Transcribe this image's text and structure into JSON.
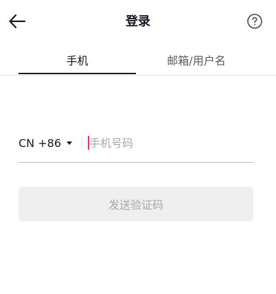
{
  "header": {
    "title": "登录",
    "back_icon": "arrow-left-icon",
    "help_icon": "question-circle-icon"
  },
  "tabs": [
    {
      "label": "手机",
      "active": true
    },
    {
      "label": "邮箱/用户名",
      "active": false
    }
  ],
  "phone": {
    "country_code": "CN +86",
    "placeholder": "手机号码",
    "value": ""
  },
  "send_button": {
    "label": "发送验证码",
    "enabled": false
  },
  "colors": {
    "text": "#161823",
    "secondary_text": "#57585f",
    "placeholder": "#a8a8ab",
    "cursor_accent": "#fe2c55",
    "button_disabled_bg": "#efeff0"
  }
}
